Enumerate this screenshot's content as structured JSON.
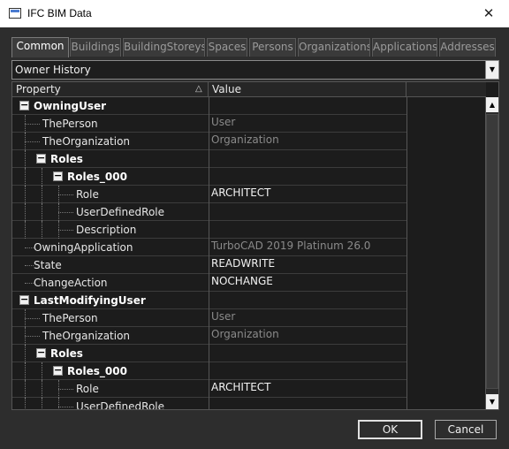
{
  "window": {
    "title": "IFC BIM Data",
    "close_glyph": "✕"
  },
  "tabs": [
    {
      "label": "Common",
      "active": true
    },
    {
      "label": "Buildings"
    },
    {
      "label": "BuildingStoreys"
    },
    {
      "label": "Spaces"
    },
    {
      "label": "Persons"
    },
    {
      "label": "Organizations"
    },
    {
      "label": "Applications"
    },
    {
      "label": "Addresses"
    }
  ],
  "category_select": {
    "value": "Owner History"
  },
  "grid": {
    "header": {
      "property": "Property",
      "value": "Value",
      "sort_glyph": "△"
    },
    "rows": [
      {
        "label": "OwningUser",
        "value": "",
        "level": 0,
        "expander": "−",
        "bold": true
      },
      {
        "label": "ThePerson",
        "value": "User",
        "level": 1,
        "readonly": true
      },
      {
        "label": "TheOrganization",
        "value": "Organization",
        "level": 1,
        "readonly": true
      },
      {
        "label": "Roles",
        "value": "",
        "level": 1,
        "expander": "−",
        "bold": true
      },
      {
        "label": "Roles_000",
        "value": "",
        "level": 2,
        "expander": "−",
        "bold": true
      },
      {
        "label": "Role",
        "value": "ARCHITECT",
        "level": 3
      },
      {
        "label": "UserDefinedRole",
        "value": "",
        "level": 3
      },
      {
        "label": "Description",
        "value": "",
        "level": 3
      },
      {
        "label": "OwningApplication",
        "value": "TurboCAD 2019 Platinum 26.0",
        "level": 0,
        "readonly": true
      },
      {
        "label": "State",
        "value": "READWRITE",
        "level": 0
      },
      {
        "label": "ChangeAction",
        "value": "NOCHANGE",
        "level": 0
      },
      {
        "label": "LastModifyingUser",
        "value": "",
        "level": 0,
        "expander": "−",
        "bold": true
      },
      {
        "label": "ThePerson",
        "value": "User",
        "level": 1,
        "readonly": true
      },
      {
        "label": "TheOrganization",
        "value": "Organization",
        "level": 1,
        "readonly": true
      },
      {
        "label": "Roles",
        "value": "",
        "level": 1,
        "expander": "−",
        "bold": true
      },
      {
        "label": "Roles_000",
        "value": "",
        "level": 2,
        "expander": "−",
        "bold": true
      },
      {
        "label": "Role",
        "value": "ARCHITECT",
        "level": 3
      },
      {
        "label": "UserDefinedRole",
        "value": "",
        "level": 3
      }
    ]
  },
  "buttons": {
    "ok": "OK",
    "cancel": "Cancel"
  }
}
